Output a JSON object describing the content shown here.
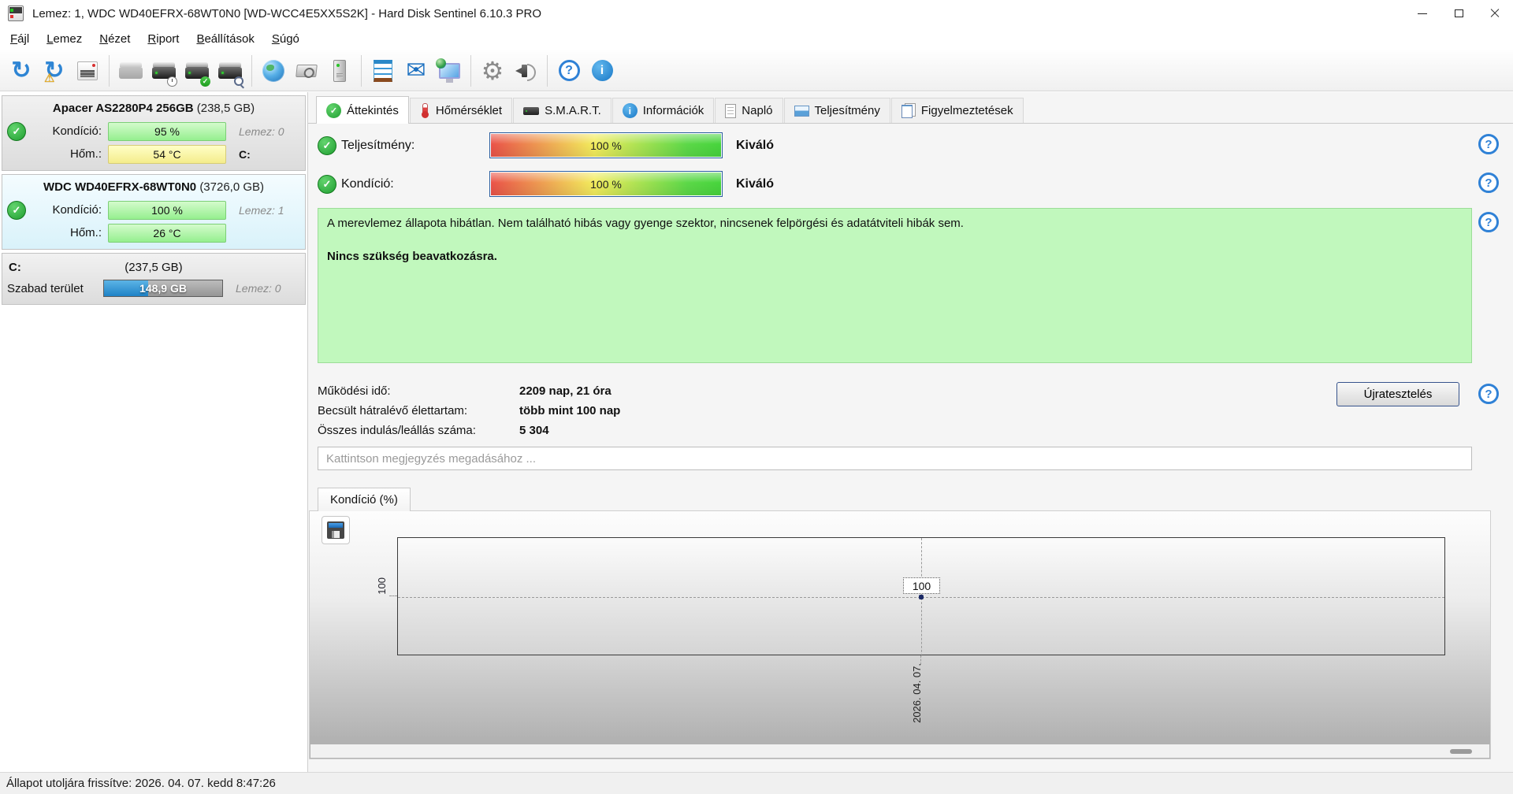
{
  "window": {
    "title": "Lemez: 1, WDC WD40EFRX-68WT0N0 [WD-WCC4E5XX5S2K]  -  Hard Disk Sentinel 6.10.3 PRO"
  },
  "menu": {
    "items": [
      "Fájl",
      "Lemez",
      "Nézet",
      "Riport",
      "Beállítások",
      "Súgó"
    ]
  },
  "toolbar": {
    "icons": [
      "refresh-icon",
      "refresh-warning-icon",
      "report-window-icon",
      "disk-disabled-icon",
      "disk-clock-icon",
      "disk-check-icon",
      "disk-search-icon",
      "network-globe-icon",
      "snapshot-camera-icon",
      "computer-tower-icon",
      "notes-icon",
      "mail-icon",
      "web-monitor-icon",
      "settings-gear-icon",
      "sound-speaker-icon",
      "help-icon",
      "info-icon"
    ]
  },
  "sidebar": {
    "disks": [
      {
        "name": "Apacer AS2280P4 256GB",
        "size": "(238,5 GB)",
        "condition_label": "Kondíció:",
        "condition_value": "95 %",
        "temp_label": "Hőm.:",
        "temp_value": "54 °C",
        "disk_label": "Lemez: 0",
        "drive_letter": "C:"
      },
      {
        "name": "WDC WD40EFRX-68WT0N0",
        "size": "(3726,0 GB)",
        "condition_label": "Kondíció:",
        "condition_value": "100 %",
        "temp_label": "Hőm.:",
        "temp_value": "26 °C",
        "disk_label": "Lemez: 1",
        "drive_letter": ""
      }
    ],
    "partition": {
      "name": "C:",
      "size": "(237,5 GB)",
      "free_label": "Szabad terület",
      "free_value": "148,9 GB",
      "disk_label": "Lemez: 0"
    }
  },
  "tabs": [
    {
      "label": "Áttekintés"
    },
    {
      "label": "Hőmérséklet"
    },
    {
      "label": "S.M.A.R.T."
    },
    {
      "label": "Információk"
    },
    {
      "label": "Napló"
    },
    {
      "label": "Teljesítmény"
    },
    {
      "label": "Figyelmeztetések"
    }
  ],
  "overview": {
    "performance_label": "Teljesítmény:",
    "performance_value": "100 %",
    "performance_rating": "Kiváló",
    "condition_label": "Kondíció:",
    "condition_value": "100 %",
    "condition_rating": "Kiváló",
    "status_line1": "A merevlemez állapota hibátlan. Nem található hibás vagy gyenge szektor, nincsenek felpörgési és adatátviteli hibák sem.",
    "status_line2": "Nincs szükség beavatkozásra.",
    "stats": [
      {
        "label": "Működési idő:",
        "value": "2209 nap, 21 óra"
      },
      {
        "label": "Becsült hátralévő élettartam:",
        "value": "több mint 100 nap"
      },
      {
        "label": "Összes indulás/leállás száma:",
        "value": "5 304"
      }
    ],
    "retest_button": "Újratesztelés",
    "comment_placeholder": "Kattintson megjegyzés megadásához ..."
  },
  "chart": {
    "tab_label": "Kondíció (%)",
    "y_axis_tick": "100",
    "point_label": "100",
    "x_axis_label": "2026. 04. 07."
  },
  "chart_data": {
    "type": "line",
    "x": [
      "2026. 04. 07."
    ],
    "series": [
      {
        "name": "Kondíció (%)",
        "values": [
          100
        ]
      }
    ],
    "title": "Kondíció (%)",
    "xlabel": "",
    "ylabel": "Kondíció (%)",
    "yticks": [
      100
    ],
    "grid": "dashed-crosshair"
  },
  "statusbar": {
    "text": "Állapot utoljára frissítve: 2026. 04. 07. kedd 8:47:26"
  },
  "colors": {
    "health_green_bar": "#95ef8f",
    "temp_yellow_bar": "#f4ec8c",
    "status_box_green": "#c1f8bd",
    "used_space_blue": "#1e82c6",
    "accent_blue": "#2f81d6",
    "meter_gradient": [
      "#ea5148",
      "#f2ec5c",
      "#46d43c"
    ]
  }
}
